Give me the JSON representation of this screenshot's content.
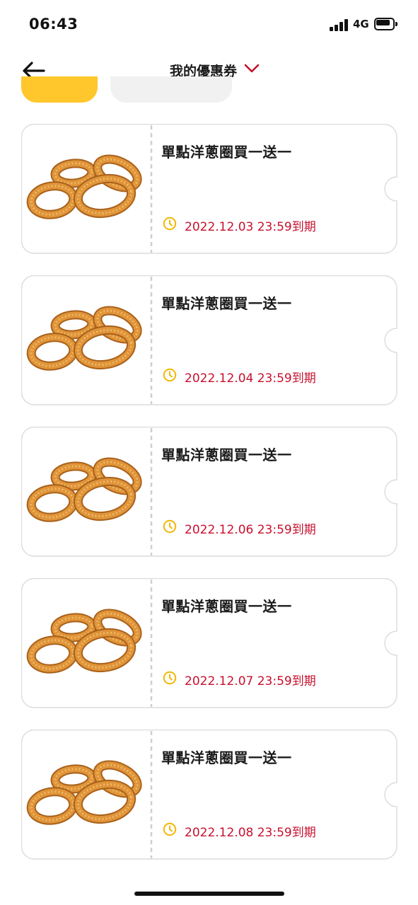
{
  "status_bar": {
    "time": "06:43",
    "network": "4G"
  },
  "header": {
    "title": "我的優惠券",
    "back_icon": "arrow-left-icon",
    "dropdown_icon": "chevron-down-icon",
    "accent_color": "#C8102E"
  },
  "filter_chips": {
    "active_color": "#FFC72C",
    "inactive_color": "#f1f1f1"
  },
  "coupons": [
    {
      "title": "單點洋蔥圈買一送一",
      "expiry": "2022.12.03 23:59到期",
      "image": "onion-rings"
    },
    {
      "title": "單點洋蔥圈買一送一",
      "expiry": "2022.12.04 23:59到期",
      "image": "onion-rings"
    },
    {
      "title": "單點洋蔥圈買一送一",
      "expiry": "2022.12.06 23:59到期",
      "image": "onion-rings"
    },
    {
      "title": "單點洋蔥圈買一送一",
      "expiry": "2022.12.07 23:59到期",
      "image": "onion-rings"
    },
    {
      "title": "單點洋蔥圈買一送一",
      "expiry": "2022.12.08 23:59到期",
      "image": "onion-rings"
    }
  ],
  "colors": {
    "expiry_text": "#C8102E",
    "clock_icon": "#F2B705",
    "card_border": "#dcdcdc"
  }
}
